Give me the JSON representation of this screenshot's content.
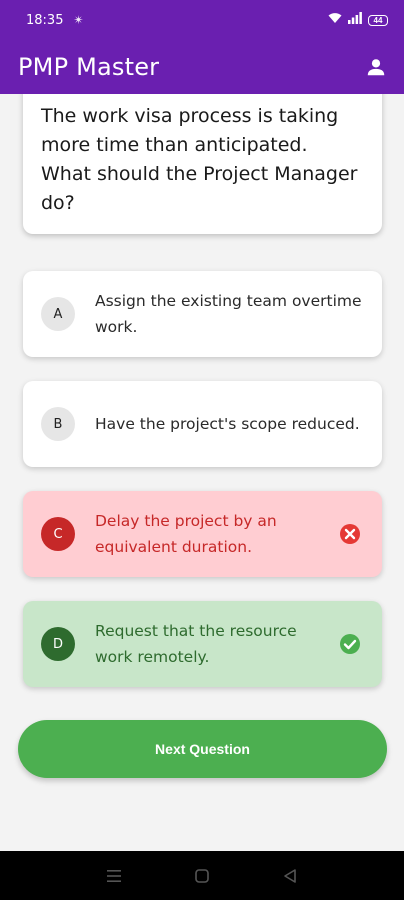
{
  "status_bar": {
    "time": "18:35",
    "extra_icon": "✴",
    "battery": "44",
    "icons": [
      "wifi-icon",
      "signal-icon",
      "battery-icon"
    ]
  },
  "app_bar": {
    "title": "PMP Master",
    "profile_icon": "person-icon"
  },
  "question": {
    "text": "The work visa process is taking more time than anticipated.\n What should the Project Manager do?"
  },
  "options": [
    {
      "letter": "A",
      "text": "Assign the existing team overtime work.",
      "state": "default"
    },
    {
      "letter": "B",
      "text": "Have the project's scope reduced.",
      "state": "default"
    },
    {
      "letter": "C",
      "text": "Delay the project by an equivalent duration.",
      "state": "wrong",
      "icon": "cancel-icon"
    },
    {
      "letter": "D",
      "text": "Request that the resource work remotely.",
      "state": "correct",
      "icon": "check-circle-icon"
    }
  ],
  "next_button": {
    "label": "Next Question"
  },
  "colors": {
    "primary": "#6a1fb0",
    "wrong_bg": "#ffcdd2",
    "wrong": "#e53935",
    "correct_bg": "#c8e6c9",
    "correct": "#4caf50"
  },
  "nav_bar": {
    "icons": [
      "menu-icon",
      "home-icon",
      "back-icon"
    ]
  }
}
